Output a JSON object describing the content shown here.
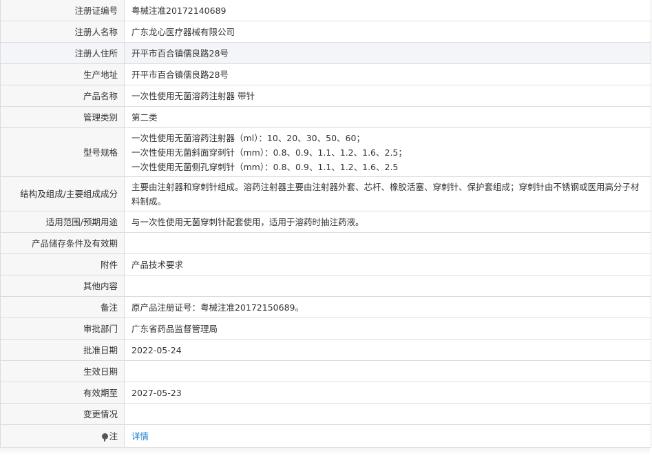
{
  "rows": [
    {
      "label": "注册证编号",
      "value": "粤械注准20172140689"
    },
    {
      "label": "注册人名称",
      "value": "广东龙心医疗器械有限公司"
    },
    {
      "label": "注册人住所",
      "value": "开平市百合镇儒良路28号"
    },
    {
      "label": "生产地址",
      "value": "开平市百合镇儒良路28号"
    },
    {
      "label": "产品名称",
      "value": "一次性使用无菌溶药注射器 带针"
    },
    {
      "label": "管理类别",
      "value": "第二类"
    },
    {
      "label": "型号规格",
      "lines": [
        "一次性使用无菌溶药注射器（ml）：10、20、30、50、60；",
        "一次性使用无菌斜面穿刺针（mm）：0.8、0.9、1.1、1.2、1.6、2.5；",
        "一次性使用无菌侧孔穿刺针（mm）：0.8、0.9、1.1、1.2、1.6、2.5"
      ]
    },
    {
      "label": "结构及组成/主要组成成分",
      "value": "主要由注射器和穿刺针组成。溶药注射器主要由注射器外套、芯杆、橡胶活塞、穿刺针、保护套组成；穿刺针由不锈钢或医用高分子材料制成。"
    },
    {
      "label": "适用范围/预期用途",
      "value": "与一次性使用无菌穿刺针配套使用，适用于溶药时抽注药液。"
    },
    {
      "label": "产品储存条件及有效期",
      "value": ""
    },
    {
      "label": "附件",
      "value": "产品技术要求"
    },
    {
      "label": "其他内容",
      "value": ""
    },
    {
      "label": "备注",
      "value": "原产品注册证号：粤械注准20172150689。"
    },
    {
      "label": "审批部门",
      "value": "广东省药品监督管理局"
    },
    {
      "label": "批准日期",
      "value": "2022-05-24"
    },
    {
      "label": "生效日期",
      "value": ""
    },
    {
      "label": "有效期至",
      "value": "2027-05-23"
    },
    {
      "label": "变更情况",
      "value": ""
    },
    {
      "label": "注",
      "value": "详情",
      "icon": "pin-icon"
    }
  ]
}
